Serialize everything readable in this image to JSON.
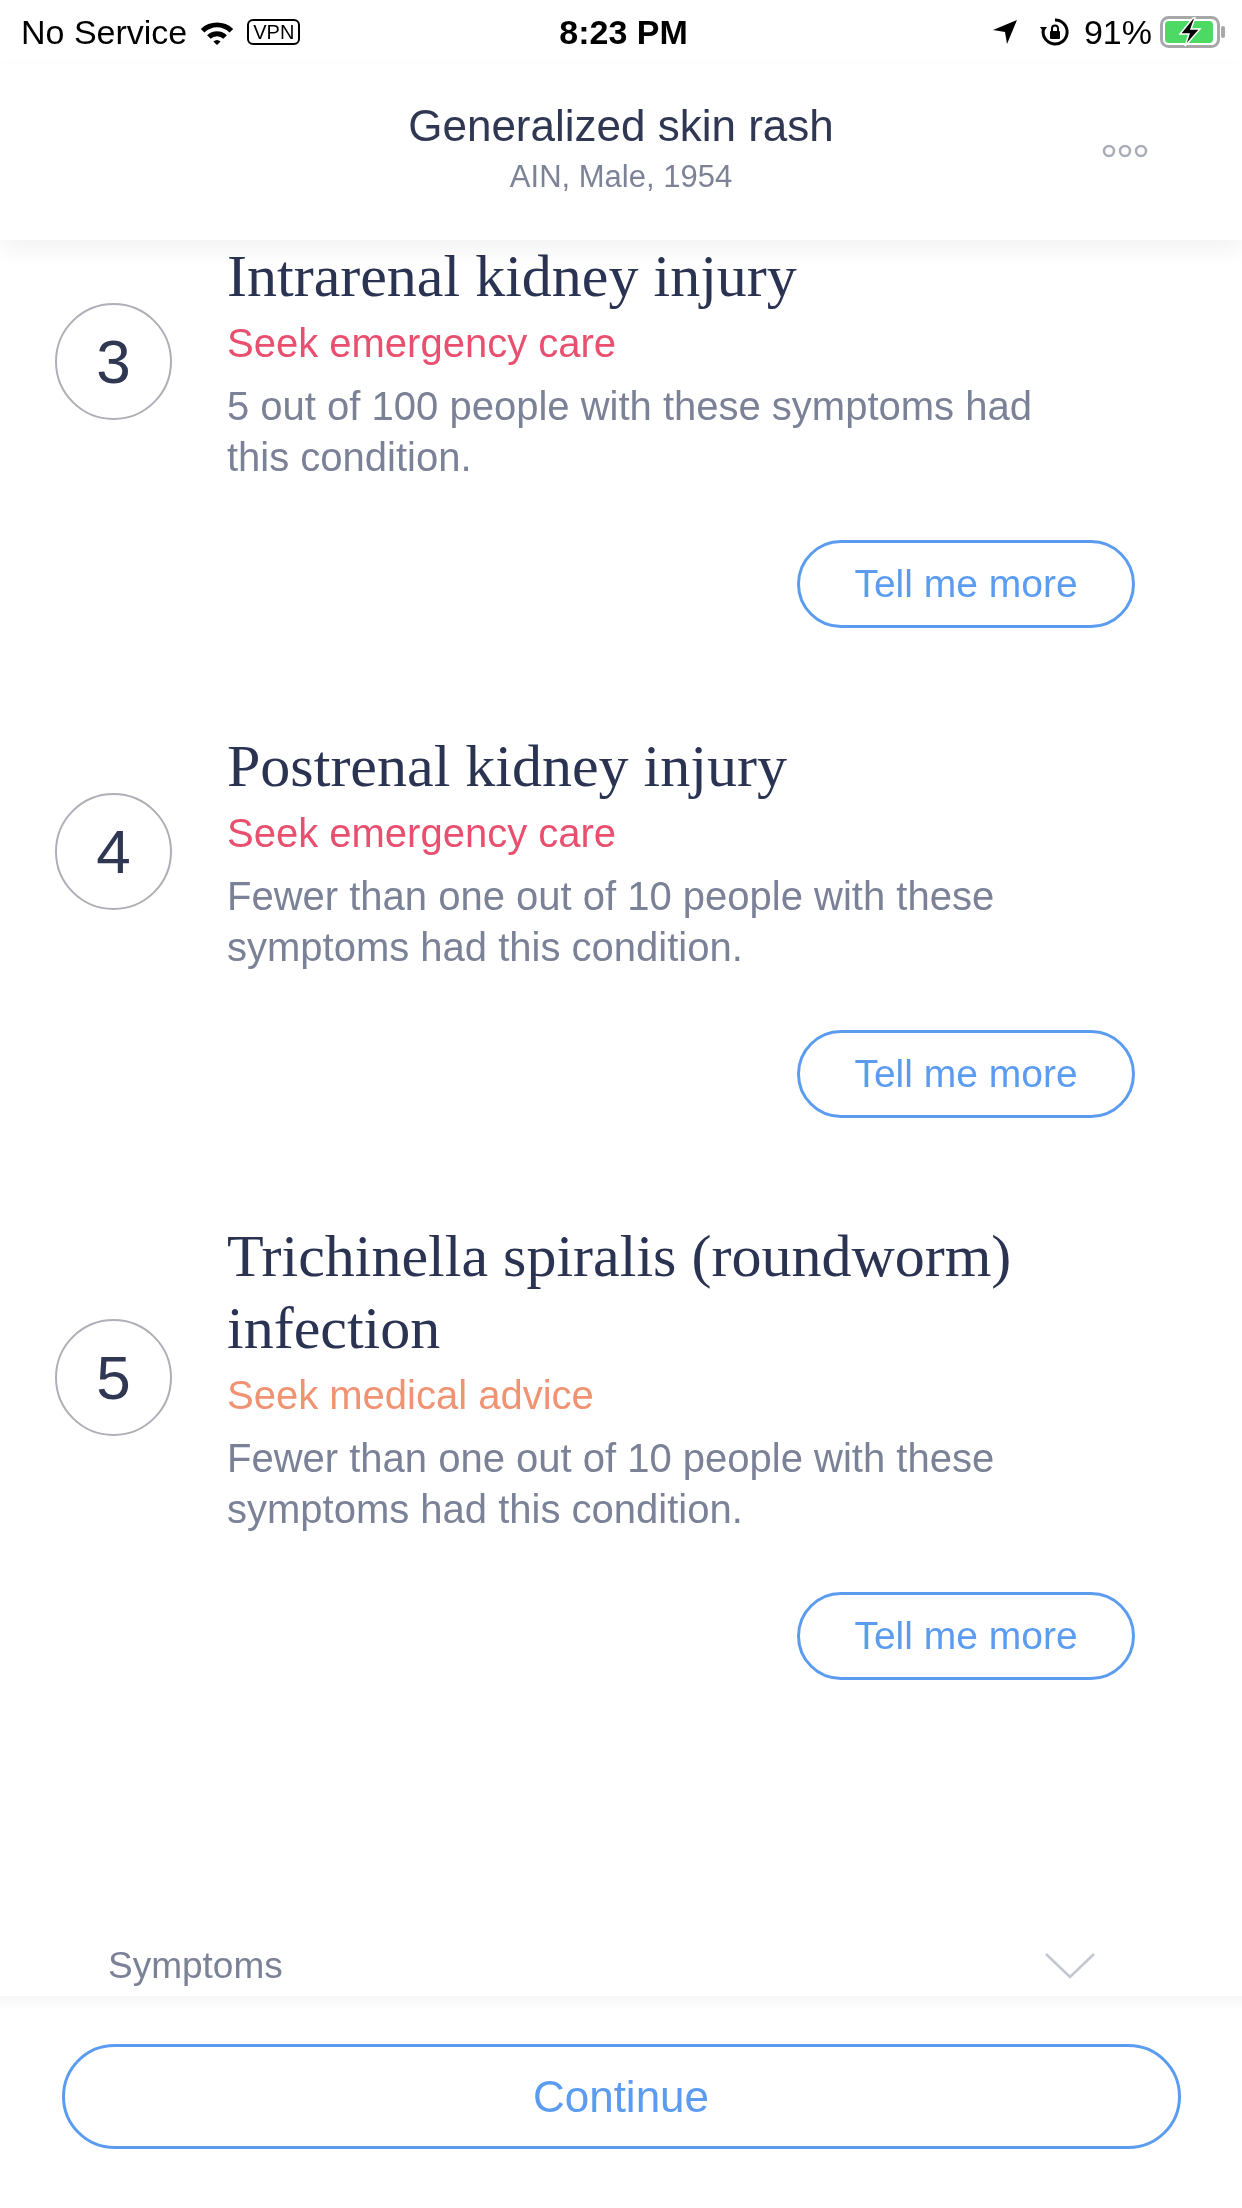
{
  "status_bar": {
    "carrier": "No Service",
    "vpn": "VPN",
    "time": "8:23 PM",
    "battery": "91%"
  },
  "header": {
    "title": "Generalized skin rash",
    "subtitle": "AIN, Male, 1954"
  },
  "conditions": [
    {
      "rank": "3",
      "name": "Intrarenal kidney injury",
      "advice": "Seek emergency care",
      "color": "#e94f6f",
      "likelihood": "5 out of 100 people with these symptoms had this condition.",
      "button": "Tell me more"
    },
    {
      "rank": "4",
      "name": "Postrenal kidney injury",
      "advice": "Seek emergency care",
      "color": "#e94f6f",
      "likelihood": "Fewer than one out of 10 people with these symptoms had this condition.",
      "button": "Tell me more"
    },
    {
      "rank": "5",
      "name": "Trichinella spiralis (roundworm) infection",
      "advice": "Seek medical advice",
      "color": "#f09373",
      "likelihood": "Fewer than one out of 10 people with these symptoms had this condition.",
      "button": "Tell me more"
    }
  ],
  "symptoms": {
    "label": "Symptoms"
  },
  "continue_button": "Continue"
}
